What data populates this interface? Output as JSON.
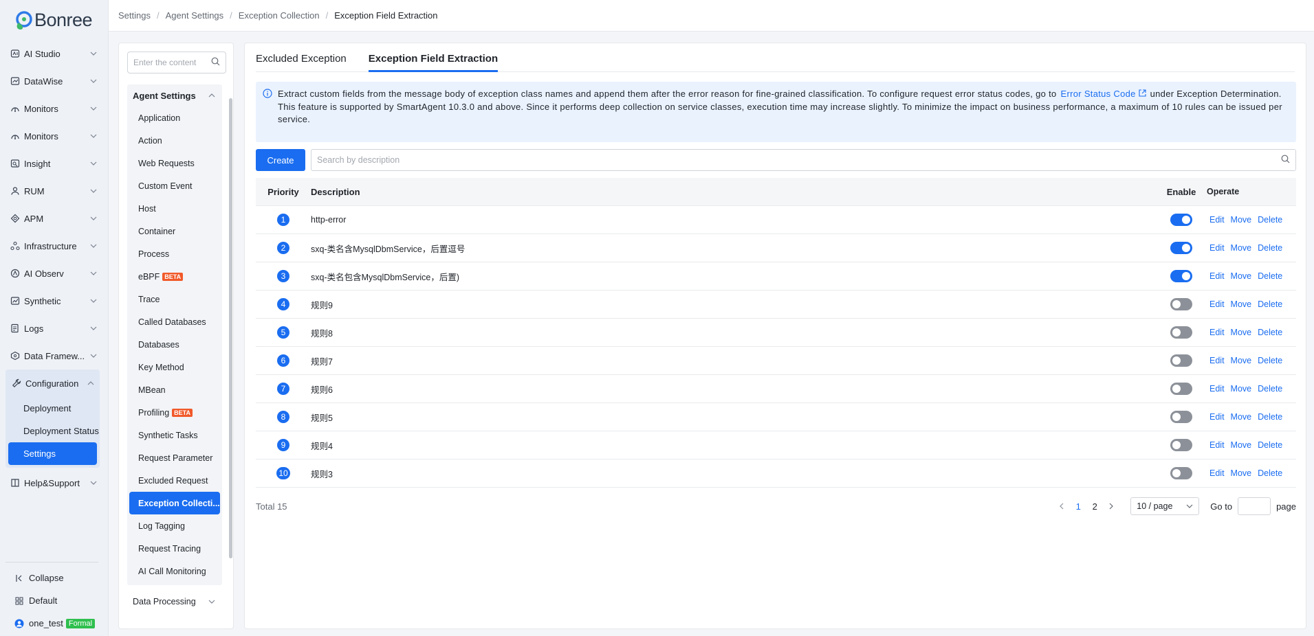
{
  "brand": {
    "name": "Bonree"
  },
  "breadcrumb": [
    "Settings",
    "Agent Settings",
    "Exception Collection",
    "Exception Field Extraction"
  ],
  "nav": {
    "items": [
      {
        "label": "AI Studio",
        "icon": "ai-studio-icon"
      },
      {
        "label": "DataWise",
        "icon": "datawise-icon"
      },
      {
        "label": "Monitors",
        "icon": "monitors-icon"
      },
      {
        "label": "Monitors",
        "icon": "monitors-icon"
      },
      {
        "label": "Insight",
        "icon": "insight-icon"
      },
      {
        "label": "RUM",
        "icon": "rum-icon"
      },
      {
        "label": "APM",
        "icon": "apm-icon"
      },
      {
        "label": "Infrastructure",
        "icon": "infrastructure-icon"
      },
      {
        "label": "AI Observ",
        "icon": "ai-observ-icon"
      },
      {
        "label": "Synthetic",
        "icon": "synthetic-icon"
      },
      {
        "label": "Logs",
        "icon": "logs-icon"
      },
      {
        "label": "Data Framew...",
        "icon": "data-framework-icon"
      }
    ],
    "configuration": {
      "label": "Configuration",
      "children": [
        "Deployment",
        "Deployment Status",
        "Settings"
      ]
    },
    "help": "Help&Support",
    "collapse": "Collapse",
    "workspace": "Default",
    "user": "one_test",
    "user_badge": "Formal"
  },
  "panel": {
    "search_placeholder": "Enter the content",
    "group_label": "Agent Settings",
    "items": [
      {
        "label": "Application"
      },
      {
        "label": "Action"
      },
      {
        "label": "Web Requests"
      },
      {
        "label": "Custom Event"
      },
      {
        "label": "Host"
      },
      {
        "label": "Container"
      },
      {
        "label": "Process"
      },
      {
        "label": "eBPF",
        "badge": "BETA"
      },
      {
        "label": "Trace"
      },
      {
        "label": "Called Databases"
      },
      {
        "label": "Databases"
      },
      {
        "label": "Key Method"
      },
      {
        "label": "MBean"
      },
      {
        "label": "Profiling",
        "badge": "BETA"
      },
      {
        "label": "Synthetic Tasks"
      },
      {
        "label": "Request Parameter"
      },
      {
        "label": "Excluded Request"
      },
      {
        "label": "Exception Collecti...",
        "active": true
      },
      {
        "label": "Log Tagging"
      },
      {
        "label": "Request Tracing"
      },
      {
        "label": "AI Call Monitoring"
      }
    ],
    "footer_group": "Data Processing"
  },
  "tabs": [
    "Excluded Exception",
    "Exception Field Extraction"
  ],
  "info": {
    "line1_pre": "Extract custom fields from the message body of exception class names and append them after the error reason for fine-grained classification. To configure request error status codes, go to",
    "link": "Error Status Code",
    "line1_post": "under Exception Determination.",
    "line2": "This feature is supported by SmartAgent 10.3.0 and above. Since it performs deep collection on service classes, execution time may increase slightly. To minimize the impact on business performance, a maximum of 10 rules can be issued per service."
  },
  "toolbar": {
    "create_label": "Create",
    "search_placeholder": "Search by description"
  },
  "table": {
    "headers": {
      "priority": "Priority",
      "description": "Description",
      "enable": "Enable",
      "operate": "Operate"
    },
    "actions": [
      "Edit",
      "Move",
      "Delete"
    ],
    "rows": [
      {
        "priority": "1",
        "description": "http-error",
        "enabled": true
      },
      {
        "priority": "2",
        "description": "sxq-类名含MysqlDbmService，后置逗号",
        "enabled": true
      },
      {
        "priority": "3",
        "description": "sxq-类名包含MysqlDbmService，后置)",
        "enabled": true
      },
      {
        "priority": "4",
        "description": "规则9",
        "enabled": false
      },
      {
        "priority": "5",
        "description": "规则8",
        "enabled": false
      },
      {
        "priority": "6",
        "description": "规则7",
        "enabled": false
      },
      {
        "priority": "7",
        "description": "规则6",
        "enabled": false
      },
      {
        "priority": "8",
        "description": "规则5",
        "enabled": false
      },
      {
        "priority": "9",
        "description": "规则4",
        "enabled": false
      },
      {
        "priority": "10",
        "description": "规则3",
        "enabled": false
      }
    ]
  },
  "pagination": {
    "total": "Total 15",
    "pages": [
      "1",
      "2"
    ],
    "current": "1",
    "page_size": "10 / page",
    "goto_label": "Go to",
    "page_label": "page"
  },
  "colors": {
    "accent": "#1a6df0",
    "beta": "#f1592a",
    "formal": "#2fbf4e"
  }
}
